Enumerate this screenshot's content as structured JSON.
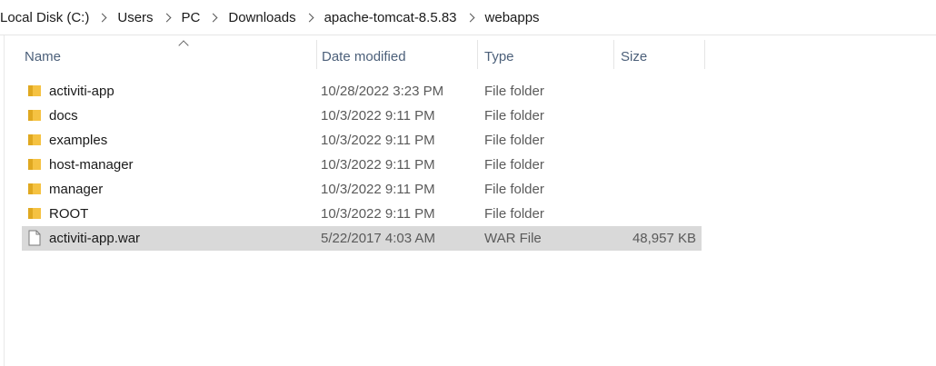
{
  "breadcrumb": [
    "Local Disk (C:)",
    "Users",
    "PC",
    "Downloads",
    "apache-tomcat-8.5.83",
    "webapps"
  ],
  "columns": {
    "name": "Name",
    "date": "Date modified",
    "type": "Type",
    "size": "Size"
  },
  "sort": {
    "column": "name",
    "direction": "ascending"
  },
  "colors": {
    "folder": "#f5c242",
    "folder_dark": "#e0a820",
    "selected_row": "#d9d9d9",
    "header_text": "#4c607a"
  },
  "files": [
    {
      "name": "activiti-app",
      "date": "10/28/2022 3:23 PM",
      "type": "File folder",
      "size": "",
      "icon": "folder-icon",
      "selected": false
    },
    {
      "name": "docs",
      "date": "10/3/2022 9:11 PM",
      "type": "File folder",
      "size": "",
      "icon": "folder-icon",
      "selected": false
    },
    {
      "name": "examples",
      "date": "10/3/2022 9:11 PM",
      "type": "File folder",
      "size": "",
      "icon": "folder-icon",
      "selected": false
    },
    {
      "name": "host-manager",
      "date": "10/3/2022 9:11 PM",
      "type": "File folder",
      "size": "",
      "icon": "folder-icon",
      "selected": false
    },
    {
      "name": "manager",
      "date": "10/3/2022 9:11 PM",
      "type": "File folder",
      "size": "",
      "icon": "folder-icon",
      "selected": false
    },
    {
      "name": "ROOT",
      "date": "10/3/2022 9:11 PM",
      "type": "File folder",
      "size": "",
      "icon": "folder-icon",
      "selected": false
    },
    {
      "name": "activiti-app.war",
      "date": "5/22/2017 4:03 AM",
      "type": "WAR File",
      "size": "48,957 KB",
      "icon": "file-icon",
      "selected": true
    }
  ]
}
